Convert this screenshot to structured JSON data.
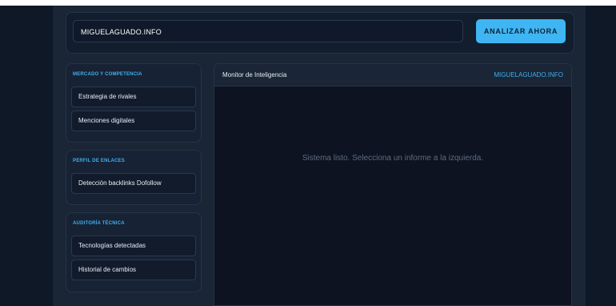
{
  "search": {
    "url_value": "MIGUELAGUADO.INFO",
    "analyze_label": "ANALIZAR AHORA"
  },
  "groups": [
    {
      "title": "MERCADO Y COMPETENCIA",
      "items": [
        "Estrategia de rivales",
        "Menciones digitales"
      ]
    },
    {
      "title": "PERFIL DE ENLACES",
      "items": [
        "Detección backlinks Dofollow"
      ]
    },
    {
      "title": "AUDITORÍA TÉCNICA",
      "items": [
        "Tecnologías detectadas",
        "Historial de cambios"
      ]
    }
  ],
  "monitor": {
    "title": "Monitor de Inteligencia",
    "domain": "MIGUELAGUADO.INFO",
    "status": "Sistema listo. Selecciona un informe a la izquierda."
  },
  "colors": {
    "accent": "#3fb6f3",
    "background": "#0f1826",
    "panel": "#1a2535"
  }
}
